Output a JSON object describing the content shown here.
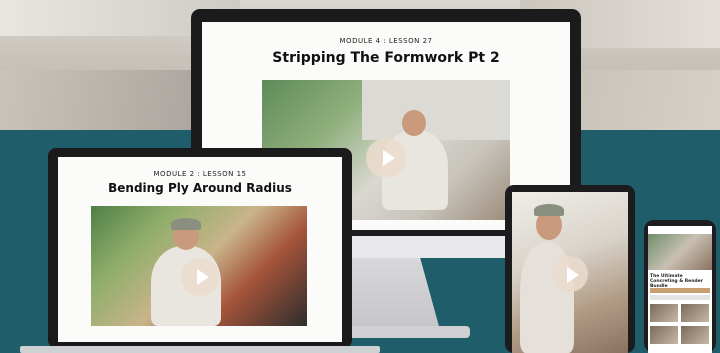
{
  "imac": {
    "module": "MODULE 4 : LESSON 27",
    "title": "Stripping The Formwork Pt 2"
  },
  "laptop": {
    "module": "MODULE 2 : LESSON 15",
    "title": "Bending Ply Around Radius"
  },
  "phone": {
    "title": "The Ultimate Concreting & Render Bundle"
  },
  "colors": {
    "background_teal": "#1e5d69",
    "device_frame": "#1b1b1d",
    "play_button": "#ebdccd"
  }
}
